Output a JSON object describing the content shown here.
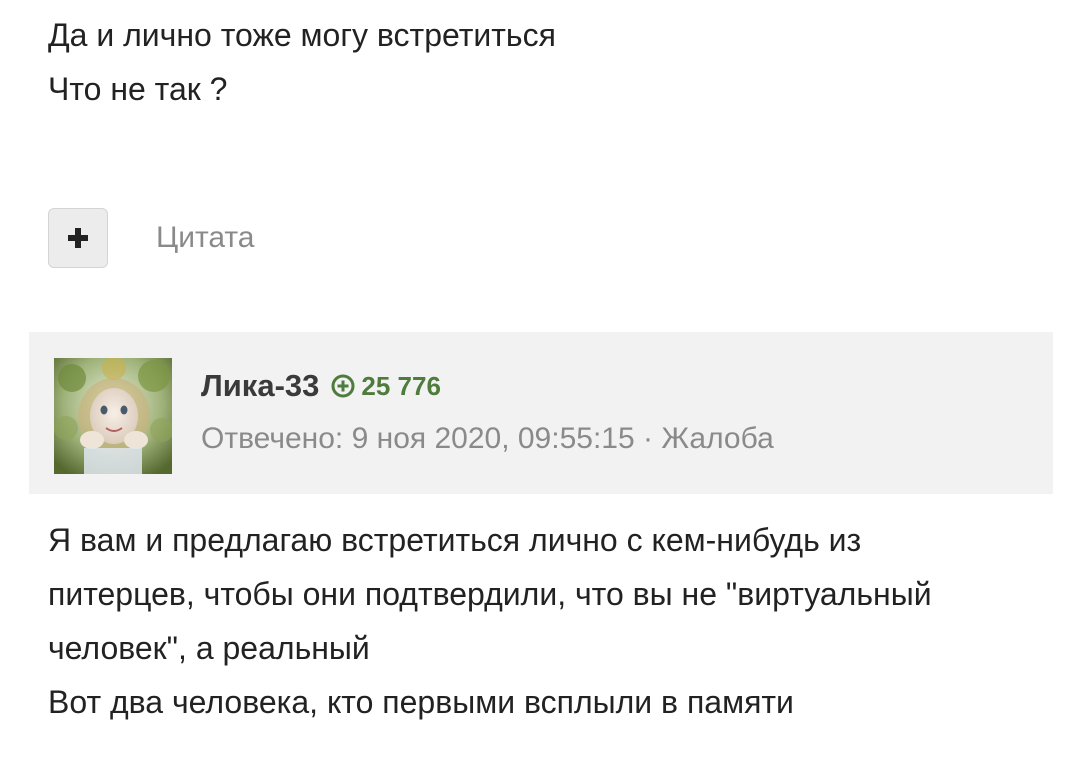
{
  "previous_answer": {
    "lines": [
      "Да и лично тоже могу встретиться",
      "Что не так ?"
    ]
  },
  "quote": {
    "plus_icon": "plus-icon",
    "label": "Цитата"
  },
  "answer": {
    "author": {
      "name": "Лика-33",
      "rating_icon": "plus-circle-icon",
      "rating": "25 776",
      "avatar": "user-avatar-image"
    },
    "meta": {
      "answered_prefix": "Отвечено:",
      "date": "9 ноя 2020, 09:55:15",
      "separator": "·",
      "report_label": "Жалоба"
    },
    "lines": [
      "Я вам и предлагаю встретиться лично с кем-нибудь из",
      "питерцев, чтобы они подтвердили, что вы не \"виртуальный",
      "человек\", а реальный",
      "Вот два человека, кто первыми всплыли в памяти"
    ]
  },
  "colors": {
    "rating_green": "#4e7c3c",
    "header_bg": "#f2f2f2",
    "muted_text": "#8a8a8a",
    "body_text": "#222222"
  }
}
